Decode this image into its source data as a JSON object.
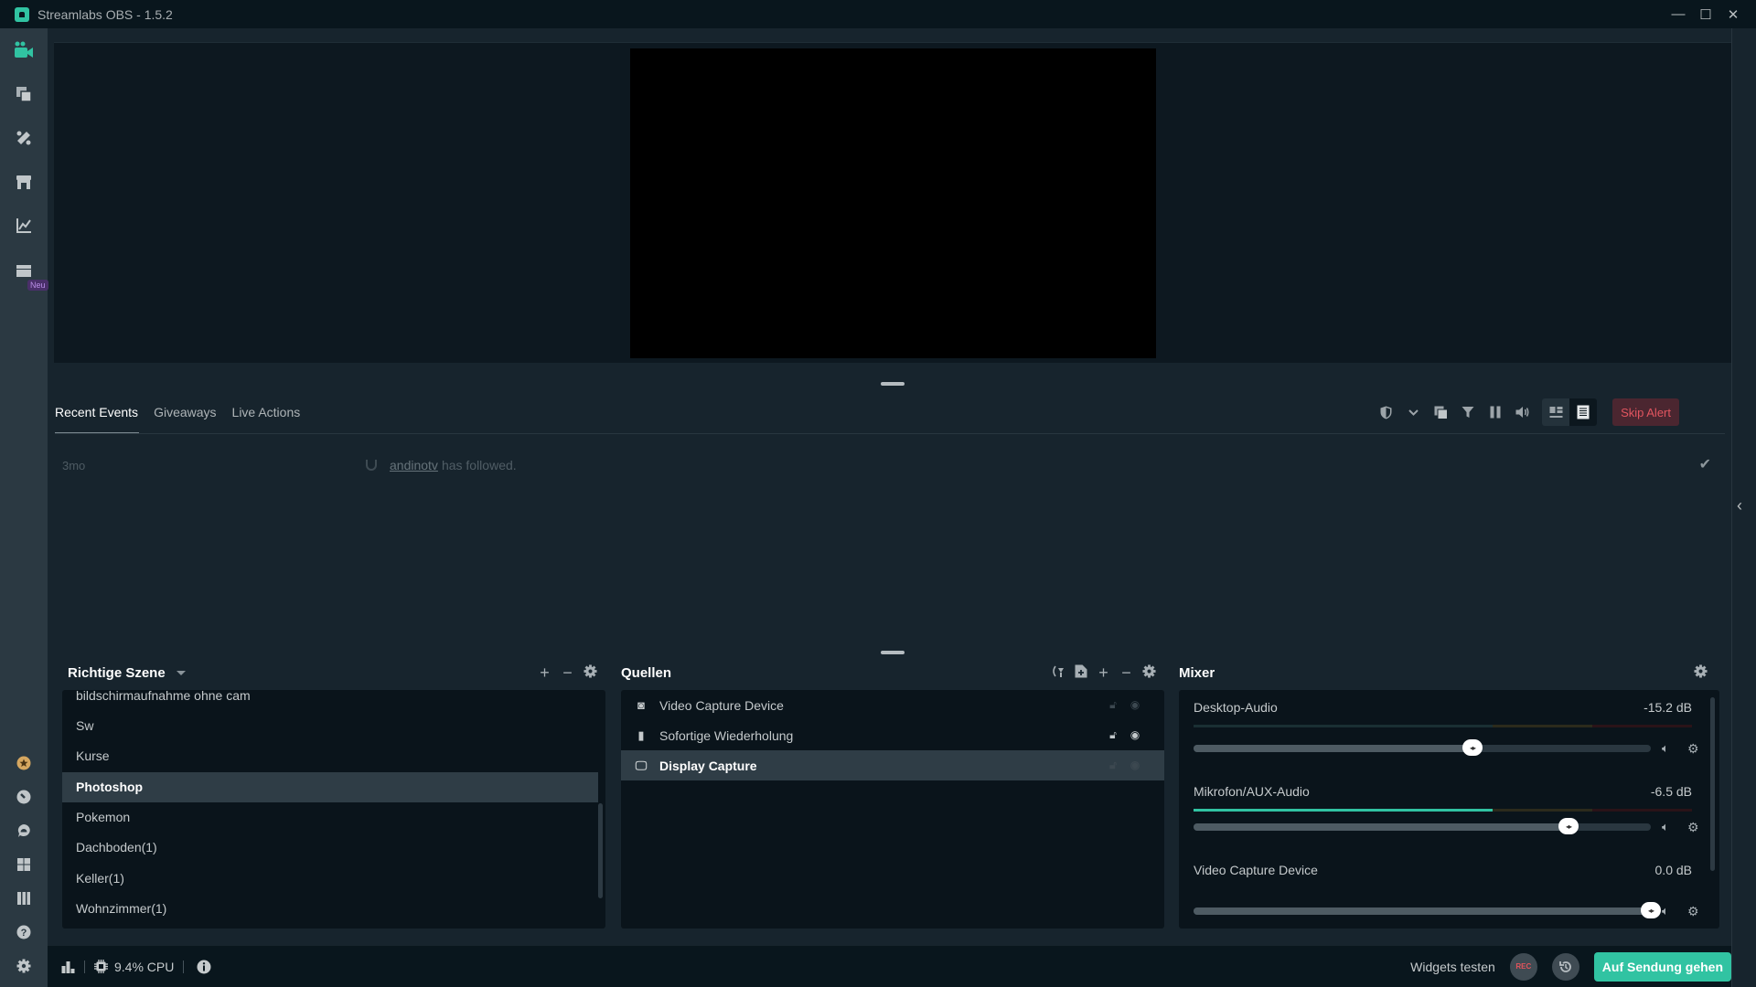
{
  "window": {
    "title": "Streamlabs OBS - 1.5.2",
    "controls": {
      "minimize": "—",
      "maximize": "☐",
      "close": "✕"
    }
  },
  "nav": {
    "top_items": [
      {
        "id": "editor",
        "icon": "camera-icon",
        "active": true
      },
      {
        "id": "layout",
        "icon": "layers-icon"
      },
      {
        "id": "themes",
        "icon": "themes-icon"
      },
      {
        "id": "store",
        "icon": "store-icon"
      },
      {
        "id": "dashboard",
        "icon": "chart-icon"
      },
      {
        "id": "highlighter",
        "icon": "clapper-icon",
        "badge": "Neu"
      }
    ],
    "bottom_items": [
      {
        "id": "prime",
        "icon": "prime-star-icon"
      },
      {
        "id": "dashboard-link",
        "icon": "gauge-icon"
      },
      {
        "id": "chat",
        "icon": "chat-icon"
      },
      {
        "id": "apps",
        "icon": "apps-grid-icon"
      },
      {
        "id": "layout-editor",
        "icon": "columns-icon"
      },
      {
        "id": "help",
        "icon": "help-icon"
      },
      {
        "id": "settings",
        "icon": "settings-icon"
      }
    ],
    "badge_new": "Neu"
  },
  "events": {
    "tabs": [
      "Recent Events",
      "Giveaways",
      "Live Actions"
    ],
    "active_tab": 0,
    "skip_alert": "Skip Alert",
    "items": [
      {
        "age": "3mo",
        "user": "andinotv",
        "action": "has followed."
      }
    ]
  },
  "scenes": {
    "title": "Richtige Szene",
    "items": [
      "bildschirmaufnahme ohne cam",
      "Sw",
      "Kurse",
      "Photoshop",
      "Pokemon",
      "Dachboden(1)",
      "Keller(1)",
      "Wohnzimmer(1)"
    ],
    "selected": "Photoshop"
  },
  "sources": {
    "title": "Quellen",
    "items": [
      {
        "name": "Video Capture Device",
        "icon": "webcam-icon",
        "visible": false,
        "locked": false
      },
      {
        "name": "Sofortige Wiederholung",
        "icon": "file-icon",
        "visible": true,
        "locked": false
      },
      {
        "name": "Display Capture",
        "icon": "monitor-icon",
        "visible": false,
        "locked": false,
        "selected": true
      }
    ]
  },
  "mixer": {
    "title": "Mixer",
    "items": [
      {
        "name": "Desktop-Audio",
        "db": "-15.2 dB",
        "volume_fraction": 0.61,
        "meter_fraction": 0.0
      },
      {
        "name": "Mikrofon/AUX-Audio",
        "db": "-6.5 dB",
        "volume_fraction": 0.82,
        "meter_fraction": 0.6
      },
      {
        "name": "Video Capture Device",
        "db": "0.0 dB",
        "volume_fraction": 1.0,
        "meter_fraction": null
      }
    ]
  },
  "footer": {
    "cpu": "9.4% CPU",
    "widgets_test": "Widgets testen",
    "rec": "REC",
    "go_live": "Auf Sendung gehen"
  },
  "colors": {
    "accent": "#31c3a2",
    "danger": "#e2545c",
    "badge_purple": "#b98ee7"
  }
}
